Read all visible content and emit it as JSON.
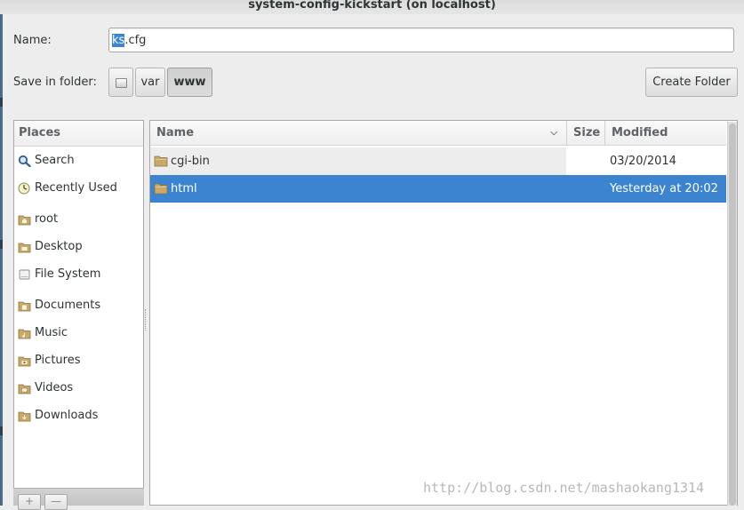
{
  "window": {
    "title": "system-config-kickstart (on localhost)"
  },
  "form": {
    "name_label": "Name:",
    "name_selected": "ks",
    "name_rest": ".cfg",
    "save_in_label": "Save in folder:"
  },
  "path_bar": {
    "root_icon": "drive-icon",
    "segments": [
      "var",
      "www"
    ],
    "active": "www"
  },
  "create_folder_label": "Create Folder",
  "places": {
    "header": "Places",
    "items": [
      {
        "label": "Search",
        "icon": "search-icon"
      },
      {
        "label": "Recently Used",
        "icon": "clock-icon"
      },
      {
        "label": "root",
        "icon": "home-folder-icon"
      },
      {
        "label": "Desktop",
        "icon": "desktop-folder-icon"
      },
      {
        "label": "File System",
        "icon": "drive-icon"
      },
      {
        "label": "Documents",
        "icon": "documents-folder-icon"
      },
      {
        "label": "Music",
        "icon": "music-folder-icon"
      },
      {
        "label": "Pictures",
        "icon": "pictures-folder-icon"
      },
      {
        "label": "Videos",
        "icon": "videos-folder-icon"
      },
      {
        "label": "Downloads",
        "icon": "downloads-folder-icon"
      }
    ],
    "add_label": "+",
    "remove_label": "—"
  },
  "files": {
    "columns": {
      "name": "Name",
      "size": "Size",
      "modified": "Modified"
    },
    "rows": [
      {
        "name": "cgi-bin",
        "size": "",
        "modified": "03/20/2014",
        "selected": false
      },
      {
        "name": "html",
        "size": "",
        "modified": "Yesterday at 20:02",
        "selected": true
      }
    ]
  },
  "watermark": "http://blog.csdn.net/mashaokang1314",
  "colors": {
    "selection": "#3d84d0",
    "folder": "#c8a96a",
    "background": "#ededed"
  }
}
